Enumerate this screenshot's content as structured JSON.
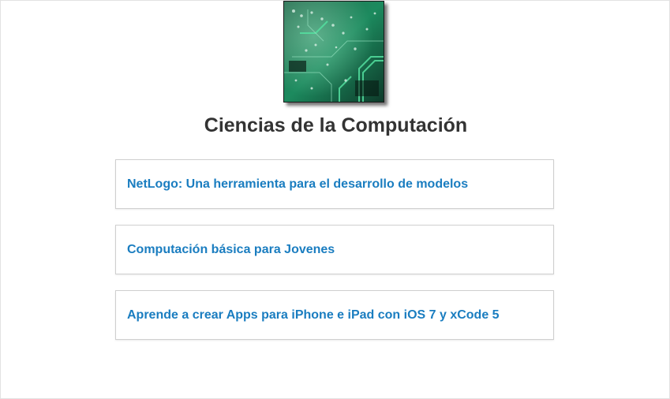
{
  "page": {
    "title": "Ciencias de la Computación",
    "thumbnail_alt": "circuit-board-image"
  },
  "courses": [
    {
      "label": "NetLogo: Una herramienta para el desarrollo de modelos"
    },
    {
      "label": "Computación básica para Jovenes"
    },
    {
      "label": "Aprende a crear Apps para iPhone e iPad con iOS 7 y xCode 5"
    }
  ],
  "colors": {
    "link": "#1a7dc0",
    "title": "#333333",
    "card_border": "#cfcfcf"
  }
}
